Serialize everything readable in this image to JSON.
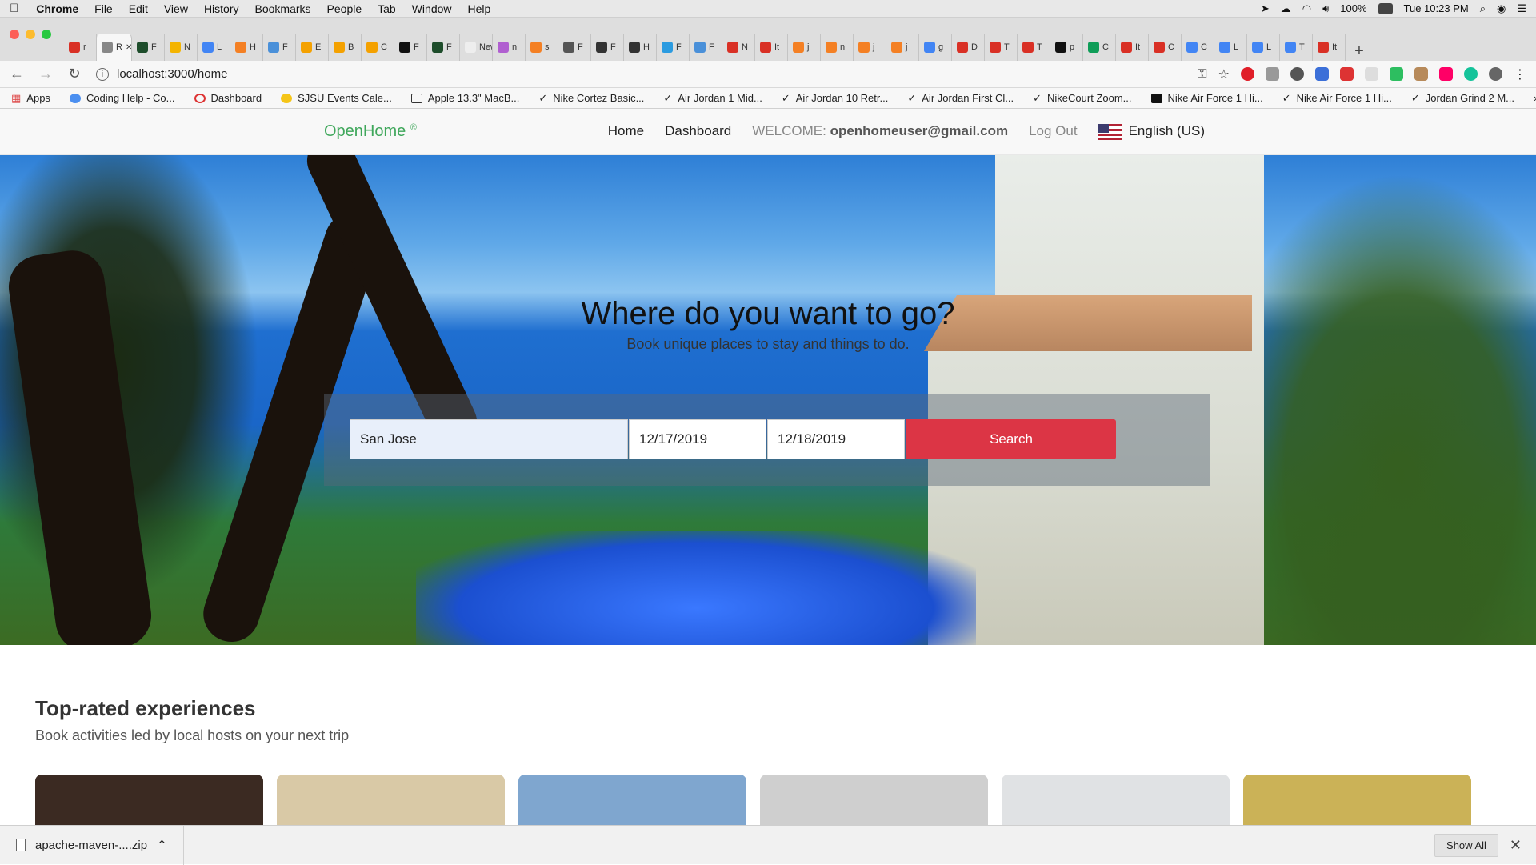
{
  "mac_menu": {
    "apple": "",
    "items": [
      "Chrome",
      "File",
      "Edit",
      "View",
      "History",
      "Bookmarks",
      "People",
      "Tab",
      "Window",
      "Help"
    ],
    "battery": "100%",
    "clock": "Tue 10:23 PM"
  },
  "tabs": [
    "r",
    "R",
    "F",
    "N",
    "L",
    "H",
    "F",
    "E",
    "B",
    "C",
    "F",
    "F",
    "New",
    "n",
    "s",
    "F",
    "F",
    "H",
    "F",
    "F",
    "N",
    "It",
    "j",
    "n",
    "j",
    "j",
    "g",
    "D",
    "T",
    "T",
    "p",
    "C",
    "It",
    "C",
    "C",
    "L",
    "L",
    "T",
    "It"
  ],
  "tab_colors": [
    "#d93025",
    "#888",
    "#1e4d2b",
    "#f4b400",
    "#4285f4",
    "#f48024",
    "#4a90d9",
    "#f4a100",
    "#f4a100",
    "#f4a100",
    "#111",
    "#1e4d2b",
    "#eee",
    "#b05fd0",
    "#f48024",
    "#555",
    "#333",
    "#333",
    "#2b9be0",
    "#4a90d9",
    "#d93025",
    "#d93025",
    "#f48024",
    "#f48024",
    "#f48024",
    "#f48024",
    "#4285f4",
    "#d93025",
    "#d93025",
    "#d93025",
    "#111",
    "#0f9d58",
    "#d93025",
    "#d93025",
    "#4285f4",
    "#4285f4",
    "#4285f4",
    "#4285f4",
    "#d93025"
  ],
  "address": {
    "url": "localhost:3000/home"
  },
  "bookmarks": [
    "Apps",
    "Coding Help - Co...",
    "Dashboard",
    "SJSU Events Cale...",
    "Apple 13.3\" MacB...",
    "Nike Cortez Basic...",
    "Air Jordan 1 Mid...",
    "Air Jordan 10 Retr...",
    "Air Jordan First Cl...",
    "NikeCourt Zoom...",
    "Nike Air Force 1 Hi...",
    "Nike Air Force 1 Hi...",
    "Jordan Grind 2 M..."
  ],
  "site": {
    "brand": "OpenHome",
    "brand_mark": "®",
    "nav": {
      "home": "Home",
      "dashboard": "Dashboard",
      "welcome_label": "WELCOME:",
      "welcome_user": "openhomeuser@gmail.com",
      "logout": "Log Out",
      "language": "English (US)"
    }
  },
  "hero": {
    "title": "Where do you want to go?",
    "subtitle": "Book unique places to stay and things to do.",
    "search": {
      "location": "San Jose",
      "check_in": "12/17/2019",
      "check_out": "12/18/2019",
      "button": "Search"
    }
  },
  "experiences": {
    "title": "Top-rated experiences",
    "subtitle": "Book activities led by local hosts on your next trip",
    "card_colors": [
      "#3b2a22",
      "#d9c9a6",
      "#7fa6cf",
      "#cfcfcf",
      "#e0e2e4",
      "#cbb257"
    ]
  },
  "downloads": {
    "file": "apache-maven-....zip",
    "show_all": "Show All"
  },
  "colors": {
    "brand": "#3fa75b",
    "search_button": "#dc3545"
  }
}
